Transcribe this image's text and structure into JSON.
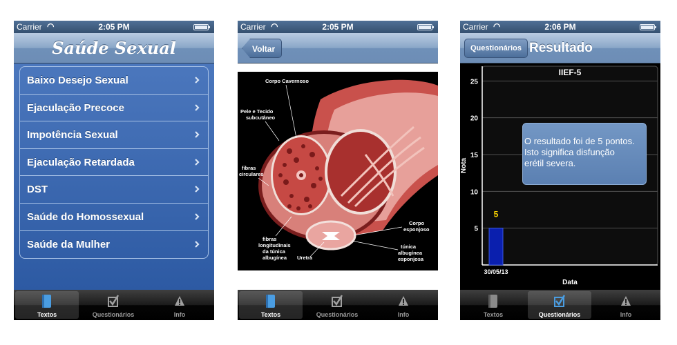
{
  "status": {
    "carrier": "Carrier",
    "time1": "2:05 PM",
    "time2": "2:05 PM",
    "time3": "2:06 PM"
  },
  "screen1": {
    "title": "Saúde Sexual",
    "items": [
      "Baixo Desejo Sexual",
      "Ejaculação Precoce",
      "Impotência Sexual",
      "Ejaculação Retardada",
      "DST",
      "Saúde do Homossexual",
      "Saúde da Mulher"
    ]
  },
  "screen2": {
    "back": "Voltar",
    "labels": {
      "corpo_cavernoso": "Corpo Cavernoso",
      "pele_1": "Pele e Tecido",
      "pele_2": "subcutâneo",
      "fibras_circ_1": "fibras",
      "fibras_circ_2": "circulares",
      "fibras_long_1": "fibras",
      "fibras_long_2": "longitudinais",
      "fibras_long_3": "da túnica",
      "fibras_long_4": "albugínea",
      "uretra": "Uretra",
      "corpo_esp_1": "Corpo",
      "corpo_esp_2": "esponjoso",
      "tunica_1": "túnica",
      "tunica_2": "albugínea",
      "tunica_3": "esponjosa"
    }
  },
  "screen3": {
    "nav_button": "Questionários",
    "title": "Resultado",
    "tooltip": [
      "O resultado foi de 5 pontos.",
      "Isto significa disfunção",
      "erétil severa."
    ]
  },
  "tabs": {
    "textos": "Textos",
    "questionarios": "Questionários",
    "info": "Info"
  },
  "colors": {
    "menu_blue": "#3a66b0",
    "bar_blue": "#0a1fae",
    "bar_label": "#ffd700"
  },
  "chart_data": {
    "type": "bar",
    "title": "IIEF-5",
    "xlabel": "Data",
    "ylabel": "Nota",
    "categories": [
      "30/05/13"
    ],
    "values": [
      5
    ],
    "data_labels": [
      "5"
    ],
    "ylim": [
      0,
      27
    ],
    "yticks": [
      5,
      10,
      15,
      20,
      25
    ],
    "grid": true
  }
}
